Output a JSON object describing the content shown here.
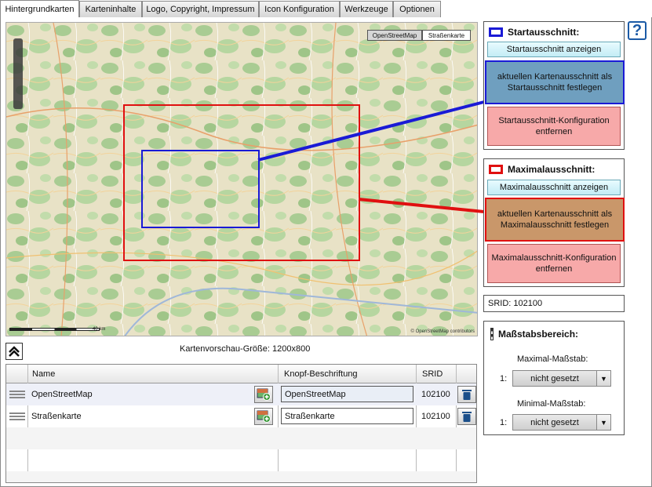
{
  "tabs": [
    {
      "label": "Hintergrundkarten",
      "active": true
    },
    {
      "label": "Karteninhalte",
      "active": false
    },
    {
      "label": "Logo, Copyright, Impressum",
      "active": false
    },
    {
      "label": "Icon Konfiguration",
      "active": false
    },
    {
      "label": "Werkzeuge",
      "active": false
    },
    {
      "label": "Optionen",
      "active": false
    }
  ],
  "map": {
    "layer_buttons": [
      "OpenStreetMap",
      "Straßenkarte"
    ],
    "scale_label": "40 km",
    "attribution": "© OpenStreetMap contributors"
  },
  "preview_size": "Kartenvorschau-Größe: 1200x800",
  "start": {
    "title": "Startausschnitt:",
    "color": "#1a1ad6",
    "show_button": "Startausschnitt anzeigen",
    "set_button": "aktuellen Kartenausschnitt als Startausschnitt festlegen",
    "remove_button": "Startausschnitt-Konfiguration entfernen"
  },
  "max": {
    "title": "Maximalausschnitt:",
    "color": "#e01010",
    "show_button": "Maximalausschnitt anzeigen",
    "set_button": "aktuellen Kartenausschnitt als Maximalausschnitt festlegen",
    "remove_button": "Maximalausschnitt-Konfiguration entfernen"
  },
  "srid": "SRID: 102100",
  "scale_range": {
    "title": "Maßstabsbereich:",
    "max_label": "Maximal-Maßstab:",
    "min_label": "Minimal-Maßstab:",
    "prefix": "1:",
    "max_value": "nicht gesetzt",
    "min_value": "nicht gesetzt"
  },
  "grid": {
    "headers": {
      "name": "Name",
      "label": "Knopf-Beschriftung",
      "srid": "SRID"
    },
    "rows": [
      {
        "name": "OpenStreetMap",
        "label": "OpenStreetMap",
        "srid": "102100"
      },
      {
        "name": "Straßenkarte",
        "label": "Straßenkarte",
        "srid": "102100"
      }
    ]
  },
  "help": "?"
}
